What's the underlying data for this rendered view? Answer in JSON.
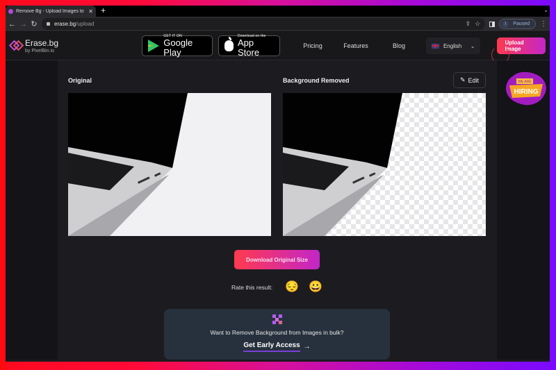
{
  "browser": {
    "tab_title": "Remove Bg - Upload Images to",
    "new_tab_symbol": "+",
    "url_host": "erase.bg",
    "url_path": "/upload",
    "profile_initial": "I",
    "profile_status": "Paused"
  },
  "header": {
    "logo_name": "Erase.bg",
    "logo_sub": "by PixelBin.io",
    "google_play": {
      "small": "GET IT ON",
      "big": "Google Play"
    },
    "app_store": {
      "small": "Download on the",
      "big": "App Store"
    },
    "nav": [
      "Pricing",
      "Features",
      "Blog"
    ],
    "language": "English",
    "upload_button": "Upload Image"
  },
  "main": {
    "original_label": "Original",
    "removed_label": "Background Removed",
    "edit_button": "Edit",
    "download_button": "Download Original Size",
    "rate_label": "Rate this result:",
    "rate_options": [
      "😔",
      "😀"
    ],
    "bulk": {
      "text": "Want to Remove Background from Images in bulk?",
      "cta": "Get Early Access",
      "arrow": "→"
    },
    "hiring_badge": {
      "top": "WE ARE",
      "main": "HIRING"
    }
  },
  "colors": {
    "accent_start": "#ff3a4e",
    "accent_end": "#c326c9",
    "bulk_bg": "#27313d"
  }
}
